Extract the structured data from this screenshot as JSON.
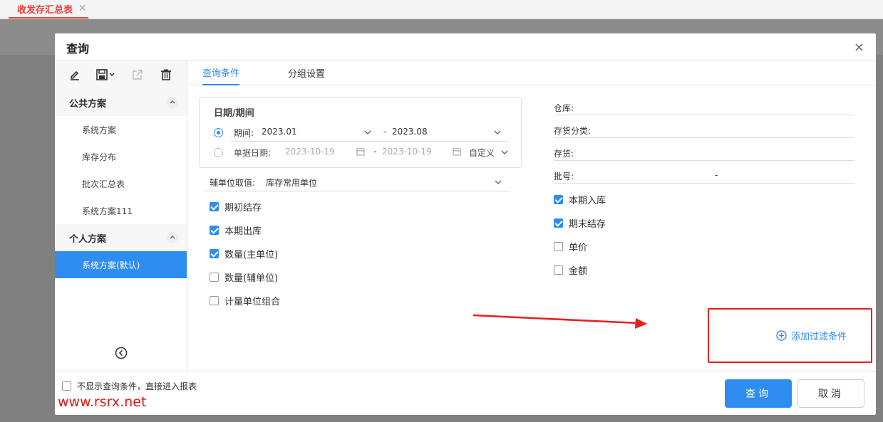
{
  "topbar": {
    "tab_label": "收发存汇总表",
    "close": "✕"
  },
  "dialog": {
    "title": "查询",
    "close": "×",
    "groups": [
      {
        "label": "公共方案",
        "items": [
          "系统方案",
          "库存分布",
          "批次汇总表",
          "系统方案111"
        ]
      },
      {
        "label": "个人方案",
        "items": [
          "系统方案(默认)"
        ]
      }
    ],
    "tabs": [
      "查询条件",
      "分组设置"
    ],
    "date": {
      "title": "日期/期间",
      "period_label": "期间:",
      "period_from": "2023.01",
      "period_sep": "-",
      "period_to": "2023.08",
      "doc_label": "单据日期:",
      "doc_from": "2023-10-19",
      "doc_sep": "-",
      "doc_to": "2023-10-19",
      "doc_mode": "自定义"
    },
    "aux_unit": {
      "label": "辅单位取值:",
      "value": "库存常用单位"
    },
    "left_checks": [
      {
        "label": "期初结存",
        "checked": true
      },
      {
        "label": "本期出库",
        "checked": true
      },
      {
        "label": "数量(主单位)",
        "checked": true
      },
      {
        "label": "数量(辅单位)",
        "checked": false
      },
      {
        "label": "计量单位组合",
        "checked": false
      }
    ],
    "fields": [
      "仓库:",
      "存货分类:",
      "存货:",
      "批号:"
    ],
    "batch_sep": "-",
    "right_checks": [
      {
        "label": "本期入库",
        "checked": true
      },
      {
        "label": "期末结存",
        "checked": true
      },
      {
        "label": "单价",
        "checked": false
      },
      {
        "label": "金额",
        "checked": false
      }
    ],
    "add_filter": "添加过滤条件",
    "skip_label": "不显示查询条件，直接进入报表",
    "query_button": "查询",
    "cancel_button": "取消"
  },
  "watermark": "www.rsrx.net",
  "colors": {
    "accent": "#2f8cf0",
    "tab_red": "#e8433d",
    "annotation_red": "#e81e1e"
  }
}
